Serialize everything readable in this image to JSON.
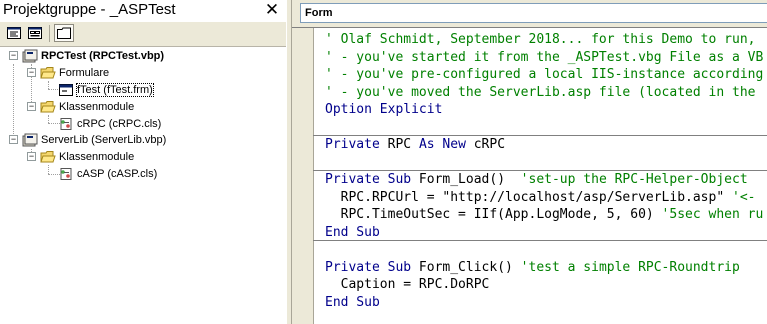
{
  "project_explorer": {
    "title": "Projektgruppe - _ASPTest",
    "close_glyph": "✕",
    "toolbar": [
      "view-code",
      "view-object",
      "toggle-folders"
    ],
    "tree": [
      {
        "label": "RPCTest (RPCTest.vbp)",
        "bold": true
      },
      {
        "label": "Formulare"
      },
      {
        "label": "fTest (fTest.frm)",
        "selected": true
      },
      {
        "label": "Klassenmodule"
      },
      {
        "label": "cRPC (cRPC.cls)"
      },
      {
        "label": "ServerLib (ServerLib.vbp)"
      },
      {
        "label": "Klassenmodule"
      },
      {
        "label": "cASP (cASP.cls)"
      }
    ]
  },
  "code_window": {
    "object_combo": "Form",
    "lines": [
      [
        {
          "t": "' Olaf Schmidt, September 2018... for this Demo to run,",
          "c": "green"
        }
      ],
      [
        {
          "t": "' - you've started it from the _ASPTest.vbg File as a VB",
          "c": "green"
        }
      ],
      [
        {
          "t": "' - you've pre-configured a local IIS-instance according",
          "c": "green"
        }
      ],
      [
        {
          "t": "' - you've moved the ServerLib.asp file (located in the ",
          "c": "green"
        }
      ],
      [
        {
          "t": "Option Explicit",
          "c": "blue"
        }
      ],
      [
        {
          "t": "",
          "c": "black"
        }
      ],
      [
        {
          "t": "Private ",
          "c": "blue"
        },
        {
          "t": "RPC ",
          "c": "black"
        },
        {
          "t": "As New ",
          "c": "blue"
        },
        {
          "t": "cRPC",
          "c": "black"
        }
      ],
      [
        {
          "t": "",
          "c": "black"
        }
      ],
      [
        {
          "t": "Private Sub ",
          "c": "blue"
        },
        {
          "t": "Form_Load()  ",
          "c": "black"
        },
        {
          "t": "'set-up the RPC-Helper-Object",
          "c": "green"
        }
      ],
      [
        {
          "t": "  RPC.RPCUrl = \"http://localhost/asp/ServerLib.asp\" ",
          "c": "black"
        },
        {
          "t": "'<-",
          "c": "green"
        }
      ],
      [
        {
          "t": "  RPC.TimeOutSec = IIf(App.LogMode, 5, 60) ",
          "c": "black"
        },
        {
          "t": "'5sec when ru",
          "c": "green"
        }
      ],
      [
        {
          "t": "End Sub",
          "c": "blue"
        }
      ],
      [
        {
          "t": "",
          "c": "black"
        }
      ],
      [
        {
          "t": "Private Sub ",
          "c": "blue"
        },
        {
          "t": "Form_Click() ",
          "c": "black"
        },
        {
          "t": "'test a simple RPC-Roundtrip",
          "c": "green"
        }
      ],
      [
        {
          "t": "  Caption = RPC.DoRPC",
          "c": "black"
        }
      ],
      [
        {
          "t": "End Sub",
          "c": "blue"
        }
      ]
    ]
  }
}
